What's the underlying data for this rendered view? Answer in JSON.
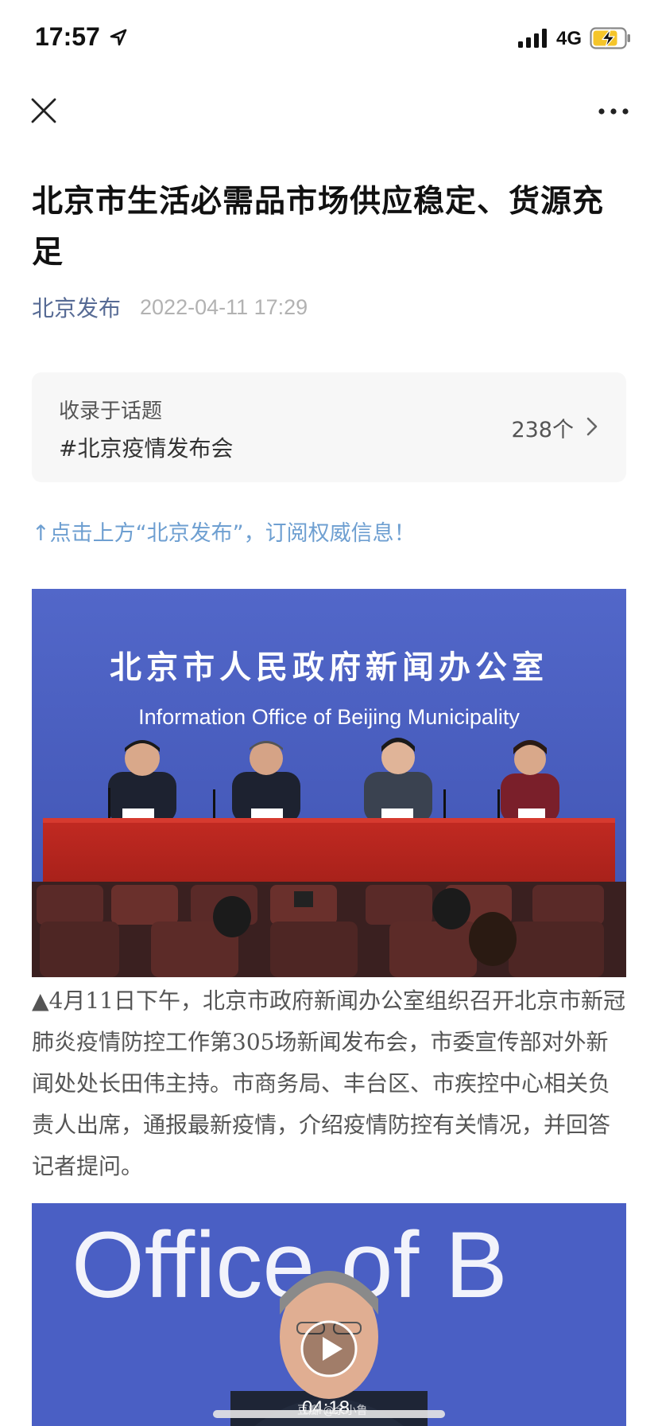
{
  "status_bar": {
    "time": "17:57",
    "network": "4G",
    "location_icon": "location-arrow-icon",
    "signal_icon": "signal-bars-icon",
    "battery_icon": "battery-charging-icon"
  },
  "nav": {
    "close_icon": "close-icon",
    "more_icon": "more-dots-icon"
  },
  "article": {
    "title": "北京市生活必需品市场供应稳定、货源充足",
    "author": "北京发布",
    "published": "2022-04-11 17:29"
  },
  "topic": {
    "label": "收录于话题",
    "name": "#北京疫情发布会",
    "count": "238个"
  },
  "subscribe_hint": "↑点击上方“北京发布”，订阅权威信息！",
  "photo": {
    "banner_cn": "北京市人民政府新闻办公室",
    "banner_en": "Information Office of Beijing Municipality"
  },
  "caption": "▲4月11日下午，北京市政府新闻办公室组织召开北京市新冠肺炎疫情防控工作第305场新闻发布会，市委宣传部对外新闻处处长田伟主持。市商务局、丰台区、市疾控中心相关负责人出席，通报最新疫情，介绍疫情防控有关情况，并回答记者提问。",
  "video": {
    "backdrop_text": "Office of B",
    "duration": "04:18",
    "watermark": "豆瓣 @余小鲁"
  },
  "colors": {
    "link": "#576b95",
    "hint": "#6e9fd1",
    "backdrop_blue": "#4a5fc4",
    "table_red": "#b5261e"
  }
}
